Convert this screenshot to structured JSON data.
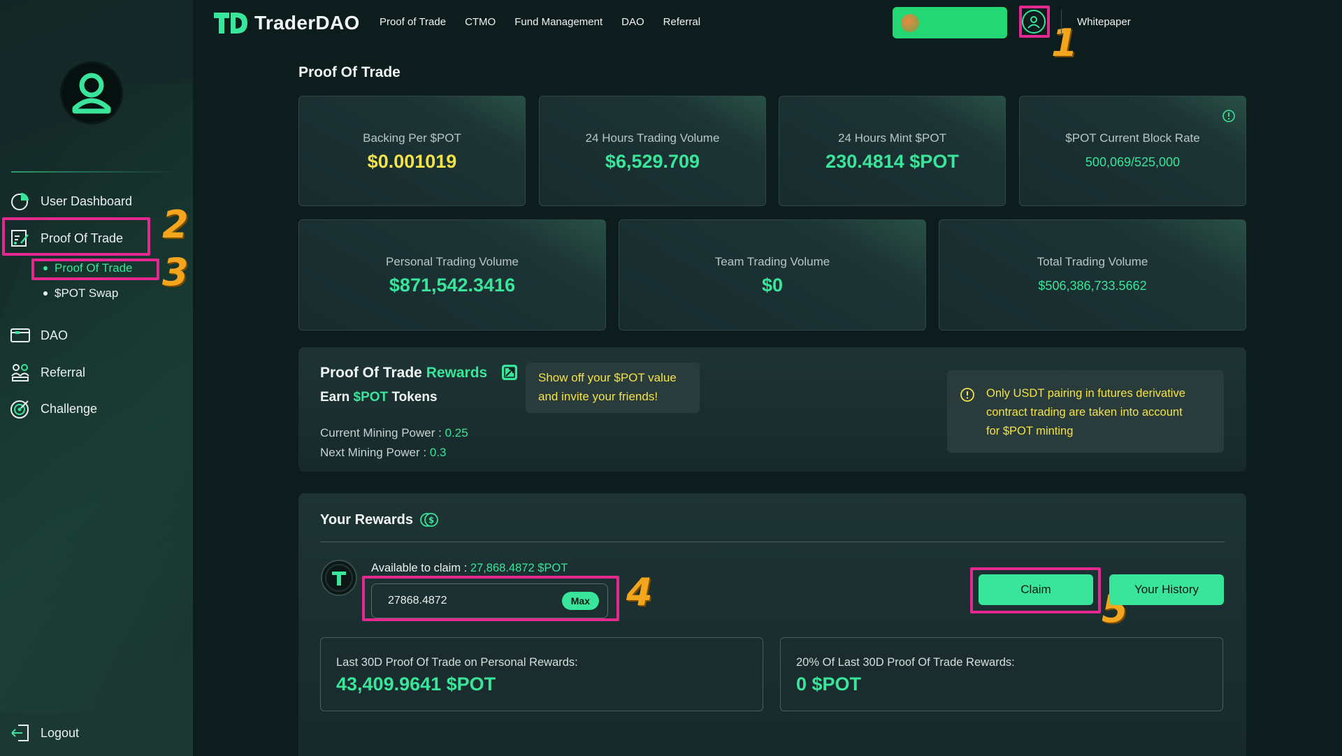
{
  "brand": {
    "name": "TraderDAO",
    "accent": "#39e59a",
    "highlight": "#f3e24a"
  },
  "top_nav": [
    "Proof of Trade",
    "CTMO",
    "Fund Management",
    "DAO",
    "Referral"
  ],
  "header": {
    "whitepaper": "Whitepaper"
  },
  "sidebar": {
    "items": [
      {
        "label": "User Dashboard",
        "icon": "pie-chart-icon"
      },
      {
        "label": "Proof Of Trade",
        "icon": "trade-chart-icon"
      },
      {
        "label": "DAO",
        "icon": "wallet-card-icon"
      },
      {
        "label": "Referral",
        "icon": "people-icon"
      },
      {
        "label": "Challenge",
        "icon": "target-icon"
      }
    ],
    "sub_items": [
      {
        "label": "Proof Of Trade",
        "active": true
      },
      {
        "label": "$POT Swap",
        "active": false
      }
    ],
    "logout": "Logout"
  },
  "annotations": [
    "1",
    "2",
    "3",
    "4",
    "5"
  ],
  "main": {
    "title": "Proof Of Trade",
    "stats_row1": [
      {
        "label": "Backing Per $POT",
        "value": "$0.001019"
      },
      {
        "label": "24 Hours Trading Volume",
        "value": "$6,529.709"
      },
      {
        "label": "24 Hours Mint $POT",
        "value": "230.4814 $POT"
      },
      {
        "label": "$POT Current Block Rate",
        "value": "500,069/525,000"
      }
    ],
    "stats_row2": [
      {
        "label": "Personal Trading Volume",
        "value": "$871,542.3416"
      },
      {
        "label": "Team Trading Volume",
        "value": "$0"
      },
      {
        "label": "Total Trading Volume",
        "value": "$506,386,733.5662"
      }
    ],
    "rewards_panel": {
      "title_a": "Proof Of Trade",
      "title_b": "Rewards",
      "subtitle_a": "Earn",
      "subtitle_b": "$POT",
      "subtitle_c": "Tokens",
      "tooltip_line1": "Show off your $POT value",
      "tooltip_line2": "and invite your friends!",
      "current_mining_label": "Current Mining Power :",
      "current_mining_value": "0.25",
      "next_mining_label": "Next Mining Power :",
      "next_mining_value": "0.3",
      "notice_line1": "Only USDT pairing in futures derivative",
      "notice_line2": "contract trading are taken into account",
      "notice_line3": "for $POT minting"
    },
    "your_rewards": {
      "title": "Your Rewards",
      "available_label": "Available to claim :",
      "available_value": "27,868.4872 $POT",
      "input_value": "27868.4872",
      "max_label": "Max",
      "claim_label": "Claim",
      "history_label": "Your History",
      "last30_label": "Last 30D Proof Of Trade on Personal Rewards:",
      "last30_value": "43,409.9641 $POT",
      "pct_label": "20% Of Last 30D Proof Of Trade Rewards:",
      "pct_value": "0 $POT"
    }
  }
}
